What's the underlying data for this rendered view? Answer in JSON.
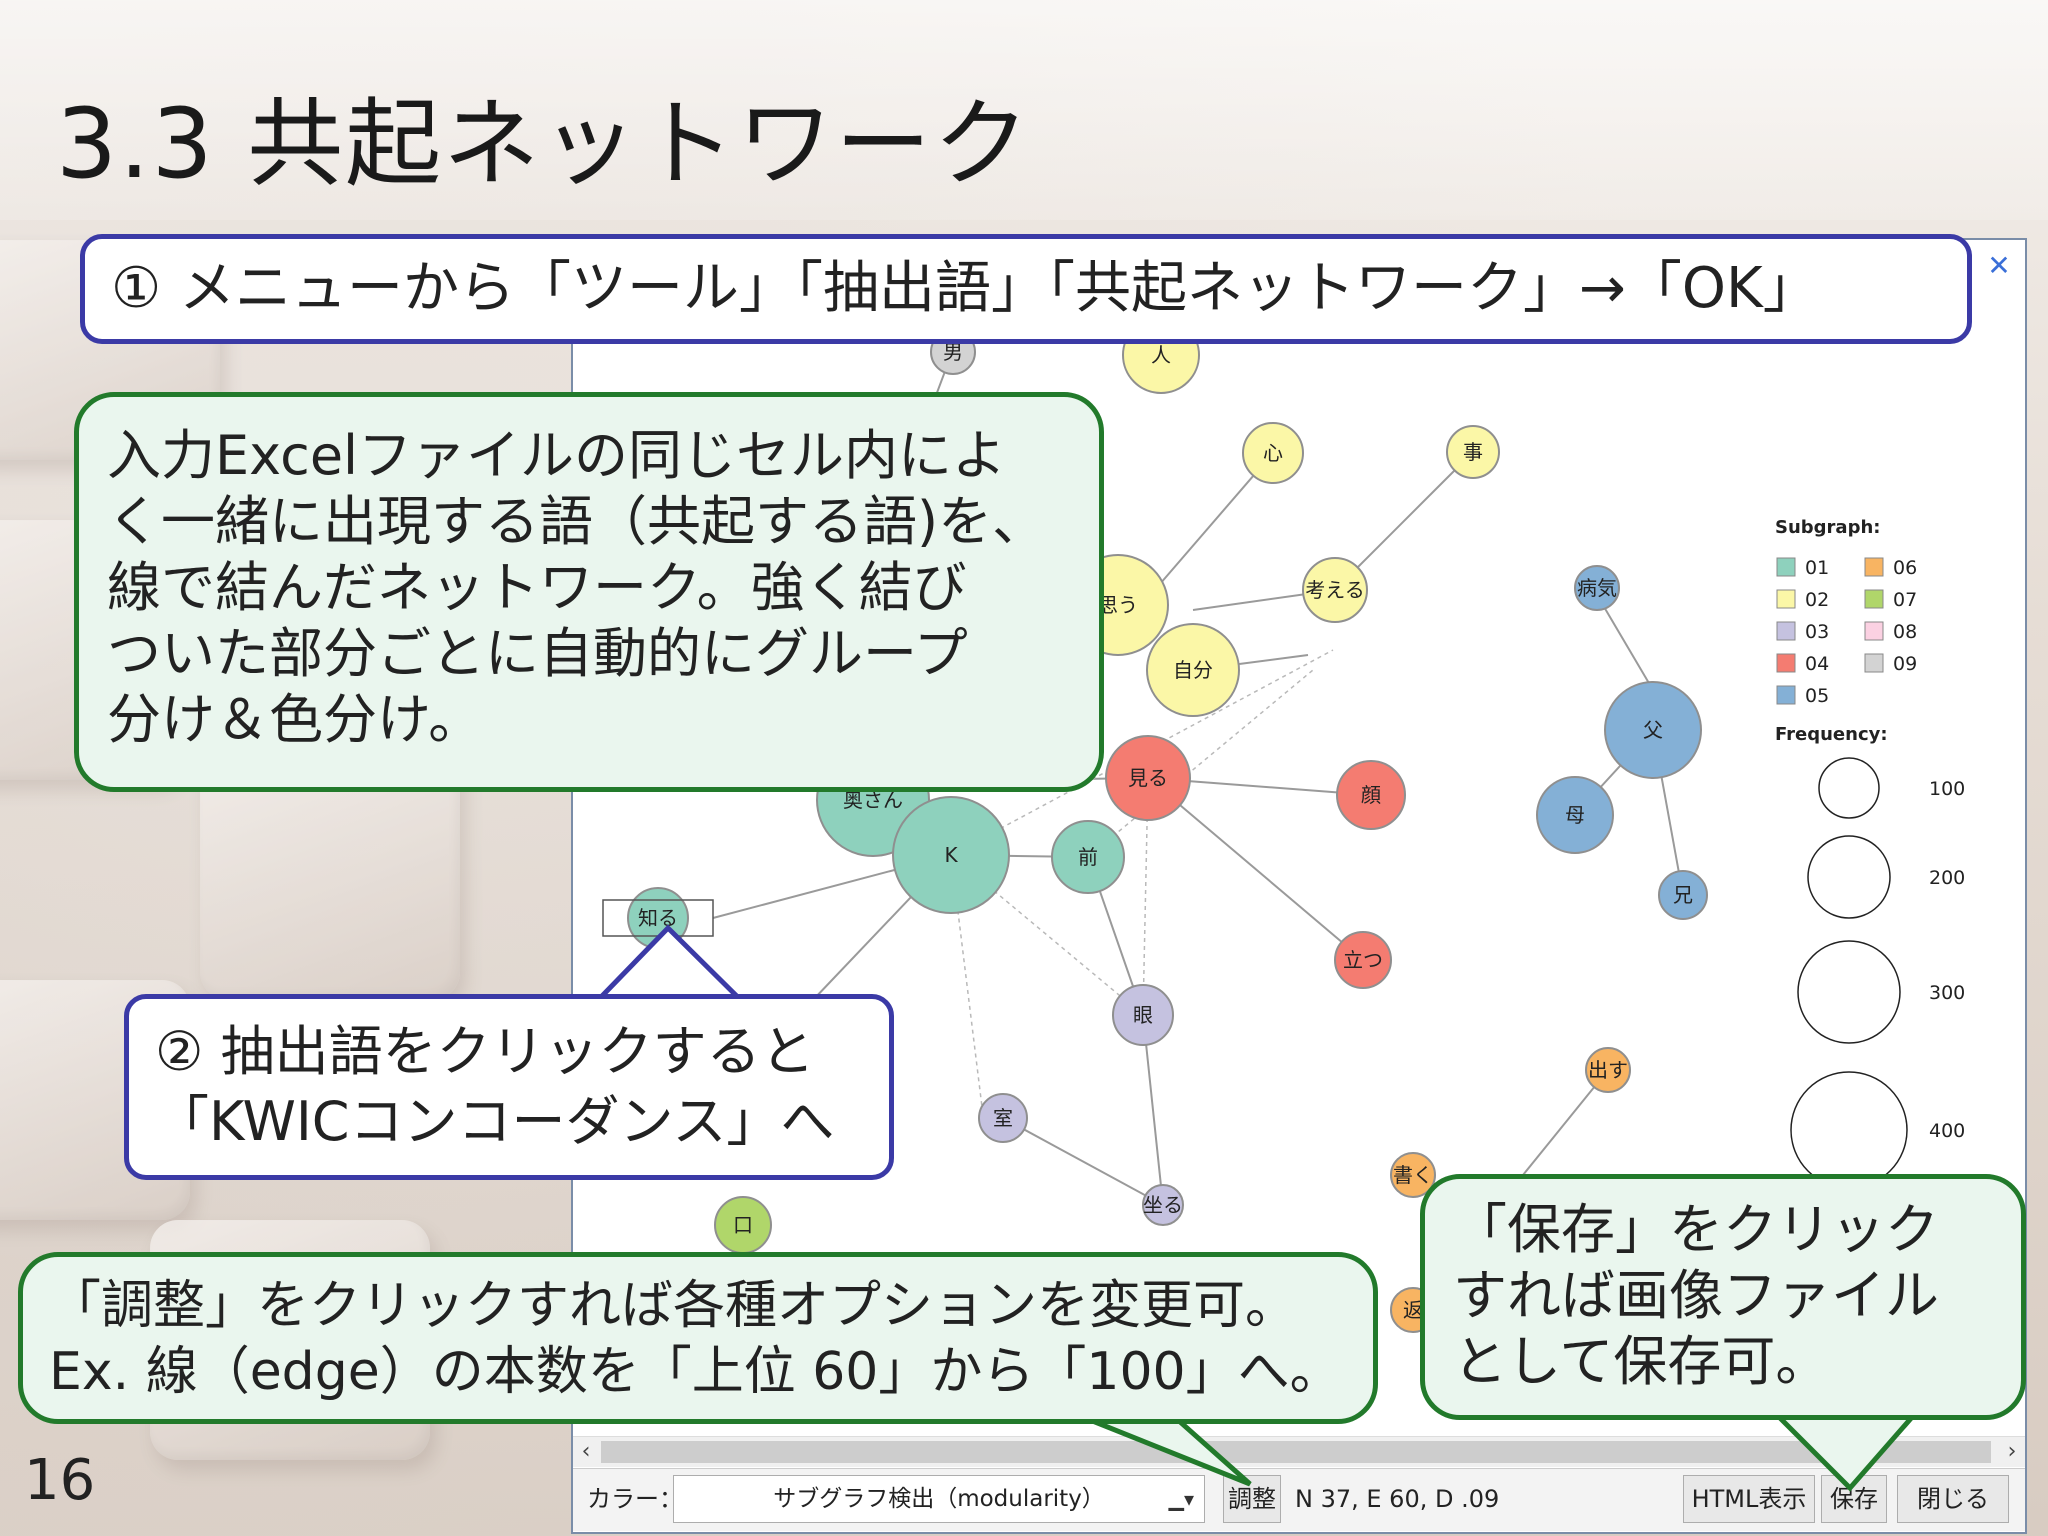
{
  "slide": {
    "title": "3.3 共起ネットワーク",
    "page_number": "16"
  },
  "callouts": {
    "step1": "① メニューから「ツール」「抽出語」「共起ネットワーク」→「OK」",
    "description": "入力Excelファイルの同じセル内によ\nく一緒に出現する語（共起する語)を、\n線で結んだネットワーク。強く結び\nついた部分ごとに自動的にグループ\n分け＆色分け。",
    "step2": "② 抽出語をクリックすると\n「KWICコンコーダンス」へ",
    "adjust": "「調整」をクリックすれば各種オプションを変更可。\nEx. 線（edge）の本数を「上位 60」から「100」へ。",
    "save": "「保存」をクリック\nすれば画像ファイル\nとして保存可。"
  },
  "window": {
    "close_icon": "close-icon"
  },
  "graph": {
    "nodes": [
      {
        "id": "otoko",
        "label": "男",
        "group": "09"
      },
      {
        "id": "hito",
        "label": "人",
        "group": "02"
      },
      {
        "id": "kokoro",
        "label": "心",
        "group": "02"
      },
      {
        "id": "koto",
        "label": "事",
        "group": "02"
      },
      {
        "id": "omou",
        "label": "思う",
        "group": "02"
      },
      {
        "id": "kangaeru",
        "label": "考える",
        "group": "02"
      },
      {
        "id": "jibun",
        "label": "自分",
        "group": "02"
      },
      {
        "id": "byouki",
        "label": "病気",
        "group": "05"
      },
      {
        "id": "chichi",
        "label": "父",
        "group": "05"
      },
      {
        "id": "haha",
        "label": "母",
        "group": "05"
      },
      {
        "id": "ani",
        "label": "兄",
        "group": "05"
      },
      {
        "id": "miru",
        "label": "見る",
        "group": "04"
      },
      {
        "id": "kao",
        "label": "顔",
        "group": "04"
      },
      {
        "id": "tatsu",
        "label": "立つ",
        "group": "04"
      },
      {
        "id": "okusan",
        "label": "奥さん",
        "group": "01"
      },
      {
        "id": "K",
        "label": "K",
        "group": "01"
      },
      {
        "id": "mae",
        "label": "前",
        "group": "01"
      },
      {
        "id": "shiru",
        "label": "知る",
        "group": "01"
      },
      {
        "id": "me",
        "label": "眼",
        "group": "03"
      },
      {
        "id": "shitsu",
        "label": "室",
        "group": "03"
      },
      {
        "id": "suwaru",
        "label": "坐る",
        "group": "03"
      },
      {
        "id": "kuchi",
        "label": "口",
        "group": "07"
      },
      {
        "id": "dasu",
        "label": "出す",
        "group": "06"
      },
      {
        "id": "kaku",
        "label": "書く",
        "group": "06"
      },
      {
        "id": "kaesu",
        "label": "返",
        "group": "06"
      }
    ]
  },
  "legend": {
    "subgraph_title": "Subgraph:",
    "subgraphs": [
      {
        "label": "01",
        "color": "#8ed1bd"
      },
      {
        "label": "02",
        "color": "#fbf7a7"
      },
      {
        "label": "03",
        "color": "#c5c2e0"
      },
      {
        "label": "04",
        "color": "#f47c71"
      },
      {
        "label": "05",
        "color": "#84b0d6"
      },
      {
        "label": "06",
        "color": "#f8b462"
      },
      {
        "label": "07",
        "color": "#b0d66a"
      },
      {
        "label": "08",
        "color": "#fbd1e2"
      },
      {
        "label": "09",
        "color": "#d3d3d3"
      }
    ],
    "frequency_title": "Frequency:",
    "frequencies": [
      "100",
      "200",
      "300",
      "400"
    ]
  },
  "toolbar": {
    "color_label": "カラー：",
    "color_value": "サブグラフ検出（modularity）",
    "adjust_button": "調整",
    "stats": "N 37, E 60, D .09",
    "html_button": "HTML表示",
    "save_button": "保存",
    "close_button": "閉じる"
  }
}
